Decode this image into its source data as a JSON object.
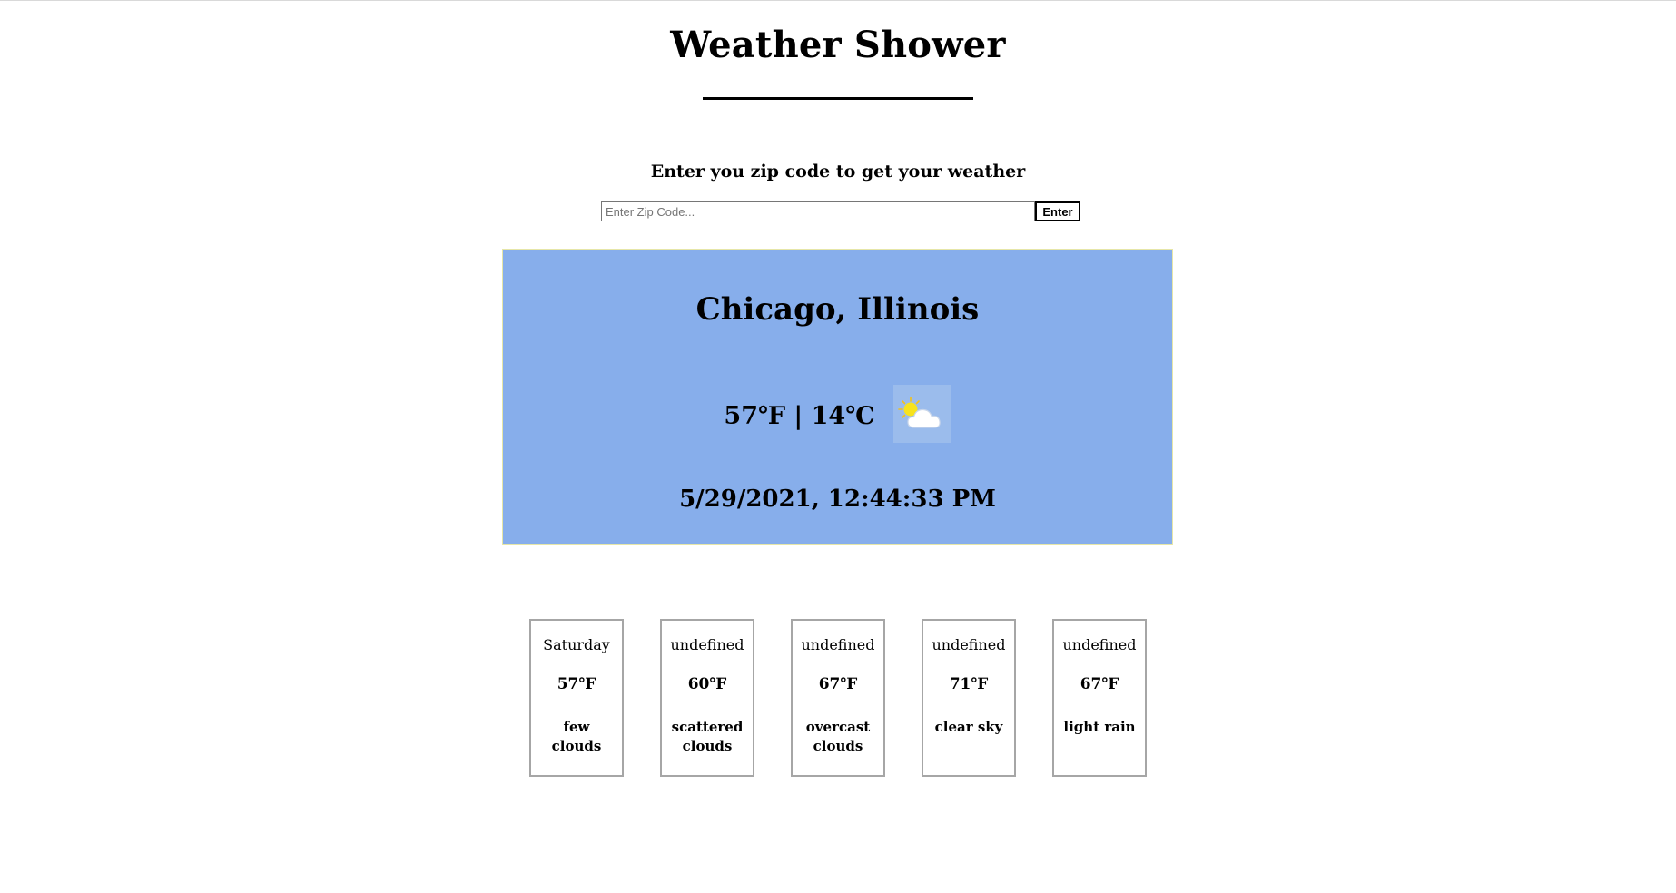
{
  "header": {
    "title": "Weather Shower",
    "prompt": "Enter you zip code to get your weather"
  },
  "search": {
    "value": "",
    "placeholder": "Enter Zip Code...",
    "button_label": "Enter"
  },
  "current": {
    "city": "Chicago, Illinois",
    "temperature": "57℉ | 14℃",
    "icon": "few-clouds-icon",
    "datetime": "5/29/2021, 12:44:33 PM"
  },
  "forecast": [
    {
      "day": "Saturday",
      "temp": "57℉",
      "desc": "few clouds"
    },
    {
      "day": "undefined",
      "temp": "60℉",
      "desc": "scattered clouds"
    },
    {
      "day": "undefined",
      "temp": "67℉",
      "desc": "overcast clouds"
    },
    {
      "day": "undefined",
      "temp": "71℉",
      "desc": "clear sky"
    },
    {
      "day": "undefined",
      "temp": "67℉",
      "desc": "light rain"
    }
  ],
  "colors": {
    "card_background": "#87aeeb",
    "card_border": "#e6e6a8",
    "forecast_border": "#a6a6a6"
  }
}
